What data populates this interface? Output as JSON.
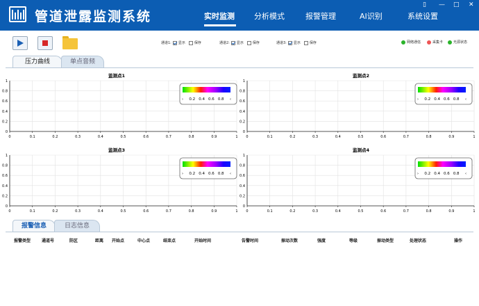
{
  "app": {
    "title": "管道泄露监测系统"
  },
  "nav": [
    {
      "label": "实时监测",
      "active": true
    },
    {
      "label": "分析模式",
      "active": false
    },
    {
      "label": "报警管理",
      "active": false
    },
    {
      "label": "AI识别",
      "active": false
    },
    {
      "label": "系统设置",
      "active": false
    }
  ],
  "window_controls": {
    "restore": "▯",
    "minimize": "—",
    "maximize": "□",
    "close": "✕"
  },
  "toolbar": {
    "channels": [
      {
        "label": "通道1:",
        "show_label": "显示",
        "show_checked": true,
        "save_label": "保存",
        "save_checked": false
      },
      {
        "label": "通道2:",
        "show_label": "显示",
        "show_checked": true,
        "save_label": "保存",
        "save_checked": false
      },
      {
        "label": "通道3:",
        "show_label": "显示",
        "show_checked": true,
        "save_label": "保存",
        "save_checked": false
      }
    ],
    "status": [
      {
        "label": "网络通信",
        "color": "#2bb32b"
      },
      {
        "label": "采集卡",
        "color": "#ee5555"
      },
      {
        "label": "光源状态",
        "color": "#2bb32b"
      }
    ]
  },
  "top_tabs": [
    {
      "label": "压力曲线",
      "active": true
    },
    {
      "label": "单点音频",
      "active": false
    }
  ],
  "bottom_tabs": [
    {
      "label": "报警信息",
      "active": true
    },
    {
      "label": "日志信息",
      "active": false
    }
  ],
  "colors": {
    "brand": "#0c5db3",
    "play": "#1a5fb4",
    "stop": "#d62828"
  },
  "chart_data": [
    {
      "type": "line",
      "title": "监测点1",
      "xlim": [
        0,
        1
      ],
      "ylim": [
        0,
        1
      ],
      "grid": true,
      "xticks": [
        "0",
        "0.1",
        "0.2",
        "0.3",
        "0.4",
        "0.5",
        "0.6",
        "0.7",
        "0.8",
        "0.9",
        "1"
      ],
      "yticks": [
        "0",
        "0.2",
        "0.4",
        "0.6",
        "0.8",
        "1"
      ],
      "colorbar": {
        "ticks": [
          "0.2",
          "0.4",
          "0.6",
          "0.8"
        ],
        "edge_left": "›",
        "edge_right": "‹"
      },
      "series": []
    },
    {
      "type": "line",
      "title": "监测点2",
      "xlim": [
        0,
        1
      ],
      "ylim": [
        0,
        1
      ],
      "grid": true,
      "xticks": [
        "0",
        "0.1",
        "0.2",
        "0.3",
        "0.4",
        "0.5",
        "0.6",
        "0.7",
        "0.8",
        "0.9",
        "1"
      ],
      "yticks": [
        "0",
        "0.2",
        "0.4",
        "0.6",
        "0.8",
        "1"
      ],
      "colorbar": {
        "ticks": [
          "0.2",
          "0.4",
          "0.6",
          "0.8"
        ],
        "edge_left": "›",
        "edge_right": "‹"
      },
      "series": []
    },
    {
      "type": "line",
      "title": "监测点3",
      "xlim": [
        0,
        1
      ],
      "ylim": [
        0,
        1
      ],
      "grid": true,
      "xticks": [
        "0",
        "0.1",
        "0.2",
        "0.3",
        "0.4",
        "0.5",
        "0.6",
        "0.7",
        "0.8",
        "0.9",
        "1"
      ],
      "yticks": [
        "0",
        "0.2",
        "0.4",
        "0.6",
        "0.8",
        "1"
      ],
      "colorbar": {
        "ticks": [
          "0.2",
          "0.4",
          "0.6",
          "0.8"
        ],
        "edge_left": "›",
        "edge_right": "‹"
      },
      "series": []
    },
    {
      "type": "line",
      "title": "监测点4",
      "xlim": [
        0,
        1
      ],
      "ylim": [
        0,
        1
      ],
      "grid": true,
      "xticks": [
        "0",
        "0.1",
        "0.2",
        "0.3",
        "0.4",
        "0.5",
        "0.6",
        "0.7",
        "0.8",
        "0.9",
        "1"
      ],
      "yticks": [
        "0",
        "0.2",
        "0.4",
        "0.6",
        "0.8",
        "1"
      ],
      "colorbar": {
        "ticks": [
          "0.2",
          "0.4",
          "0.6",
          "0.8"
        ],
        "edge_left": "›",
        "edge_right": "‹"
      },
      "series": []
    }
  ],
  "alarm_table": {
    "columns": [
      "报警类型",
      "通道号",
      "防区",
      "距离",
      "开始点",
      "中心点",
      "结束点",
      "开始时间",
      "告警时间",
      "振动次数",
      "强度",
      "等级",
      "振动类型",
      "处理状态",
      "操作"
    ],
    "rows": []
  }
}
